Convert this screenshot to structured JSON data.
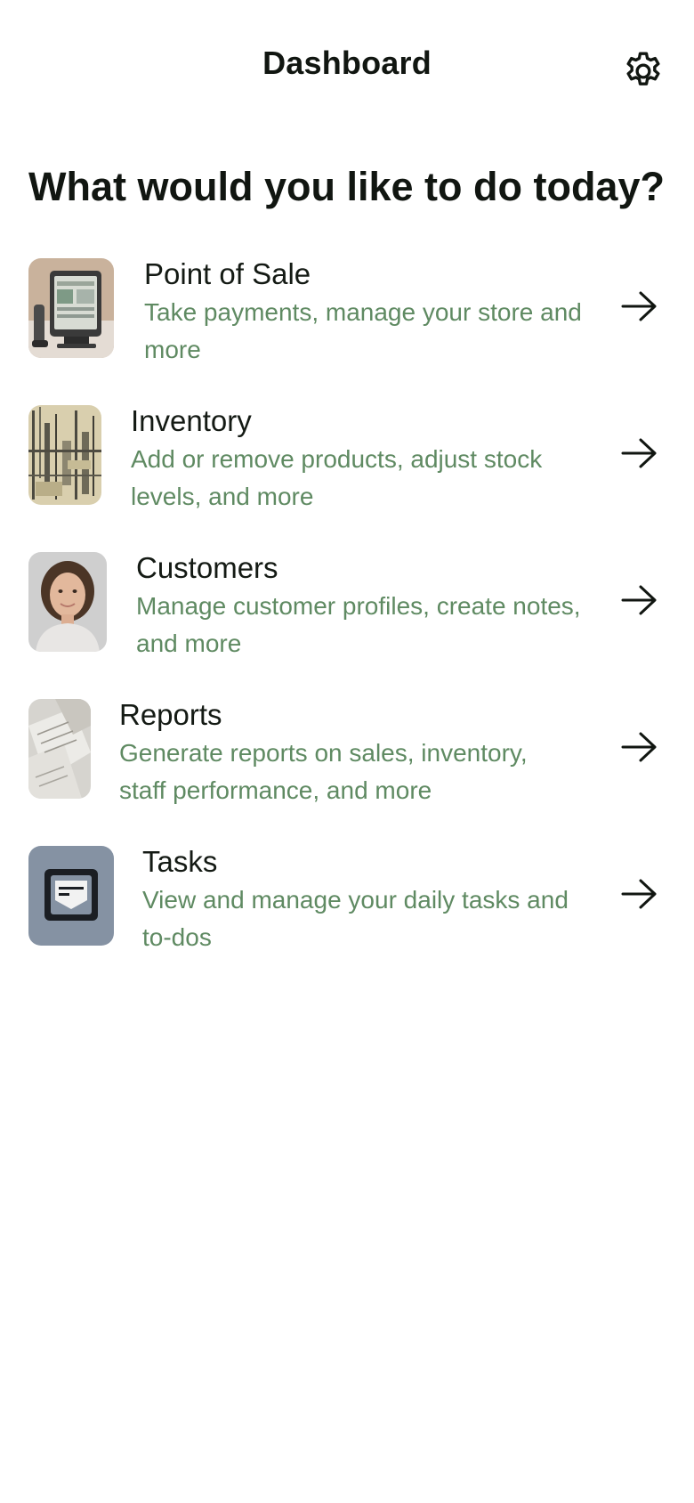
{
  "header": {
    "title": "Dashboard",
    "settings_icon": "gear-icon"
  },
  "headline": "What would you like to do today?",
  "menu": {
    "items": [
      {
        "id": "point-of-sale",
        "title": "Point of Sale",
        "description": "Take payments, manage your store and more",
        "thumbnail": "pos-terminal-image",
        "arrow_icon": "arrow-right-icon"
      },
      {
        "id": "inventory",
        "title": "Inventory",
        "description": "Add or remove products, adjust stock levels, and more",
        "thumbnail": "inventory-abstract-image",
        "arrow_icon": "arrow-right-icon"
      },
      {
        "id": "customers",
        "title": "Customers",
        "description": "Manage customer profiles, create notes, and more",
        "thumbnail": "customer-portrait-image",
        "arrow_icon": "arrow-right-icon"
      },
      {
        "id": "reports",
        "title": "Reports",
        "description": "Generate reports on sales, inventory, staff performance, and more",
        "thumbnail": "reports-papers-image",
        "arrow_icon": "arrow-right-icon"
      },
      {
        "id": "tasks",
        "title": "Tasks",
        "description": "View and manage your daily tasks and to-dos",
        "thumbnail": "tasks-icon-tile",
        "arrow_icon": "arrow-right-icon"
      }
    ]
  },
  "colors": {
    "text": "#141a14",
    "description": "#5f8a62",
    "background": "#ffffff",
    "tasks_tile": "#8592a3"
  }
}
